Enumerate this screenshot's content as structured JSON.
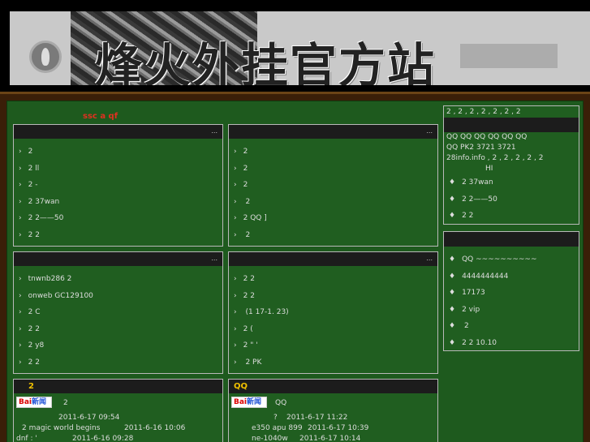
{
  "banner": {
    "title": "烽火外挂官方站"
  },
  "marquee": "ssc a qf",
  "boxes": {
    "b1": {
      "more": "...",
      "items": [
        "2",
        "2       ll",
        "2     -",
        "2     37wan",
        "2     2——50",
        "2       2"
      ]
    },
    "b2": {
      "more": "...",
      "items": [
        "2",
        "2",
        "2",
        "        2",
        "2    QQ ]",
        "    2"
      ]
    },
    "b3": {
      "more": "...",
      "items": [
        "tnwnb286  2",
        "onweb     GC129100",
        "2        C",
        "2         2",
        "2           y8",
        "2         2"
      ]
    },
    "b4": {
      "more": "...",
      "items": [
        "2         2",
        "2         2",
        "    (1 17-1. 23)",
        "2            (",
        "2 \"     '",
        "        2 PK"
      ]
    },
    "b5": {
      "title": "2",
      "header_text": "2",
      "rows": [
        {
          "t": "2011-6-17 09:54",
          "d": ""
        },
        {
          "t": "2      magic world begins",
          "d": "2011-6-16 10:06"
        },
        {
          "t": "dnf  :   '",
          "d": "2011-6-16 09:28"
        }
      ]
    },
    "b6": {
      "title": "QQ",
      "header_text": "QQ",
      "rows": [
        {
          "t": "?",
          "d": "2011-6-17 11:22"
        },
        {
          "t": "e350 apu 899",
          "d": "2011-6-17 10:39"
        },
        {
          "t": "ne-1040w",
          "d": "2011-6-17 10:14"
        }
      ]
    },
    "r1": {
      "top": "2  , 2  , 2  , 2  , 2  , 2  , 2",
      "line2": "QQ      QQ      QQ      QQ      QQ      QQ",
      "line3": "QQ    PK2   3721   3721",
      "line4": "28info.info  , 2  , 2  , 2  , 2  , 2",
      "hi": "HI",
      "items": [
        "2     37wan",
        "2     2——50",
        "2       2"
      ]
    },
    "r2": {
      "items": [
        "QQ     ~~~~~~~~~~",
        "4444444444",
        "17173",
        "2    vip",
        "          2",
        "2      2 10.10"
      ]
    }
  },
  "icons": {
    "baidu": "Baiดุ้ย"
  },
  "baidu_text": "Bai 新闻"
}
